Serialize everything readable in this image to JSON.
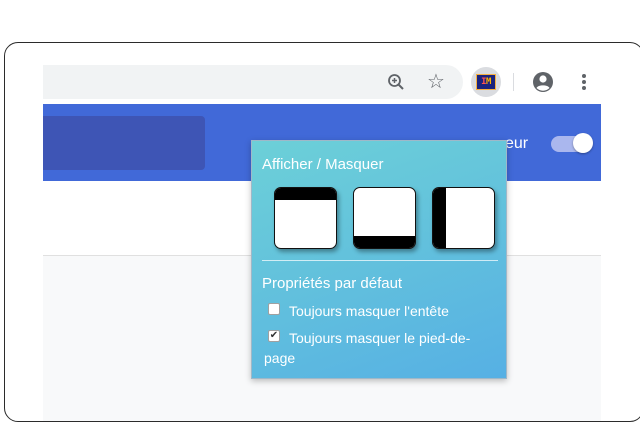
{
  "toolbar": {
    "zoom_icon": "zoom-in-icon",
    "bookmark_icon": "star-icon",
    "extension_badge": [
      "I",
      "M"
    ],
    "profile_icon": "account-circle-icon",
    "menu_icon": "more-vert-icon"
  },
  "banner": {
    "text": "eur",
    "toggle_on": true
  },
  "popup": {
    "title": "Afficher / Masquer",
    "layouts": [
      "hide-header",
      "hide-footer",
      "hide-sidebar"
    ],
    "defaults_title": "Propriétés par défaut",
    "options": [
      {
        "label": "Toujours masquer l'entête",
        "checked": false
      },
      {
        "label": "Toujours masquer le pied-de-page",
        "checked": true
      }
    ]
  },
  "colors": {
    "banner": "#4169d8",
    "popup_gradient_start": "#6cd0d8",
    "popup_gradient_end": "#56b0e4"
  }
}
